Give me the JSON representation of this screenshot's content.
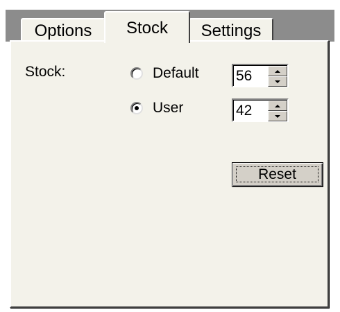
{
  "tabs": {
    "options": "Options",
    "stock": "Stock",
    "settings": "Settings"
  },
  "stock_panel": {
    "label": "Stock:",
    "default_label": "Default",
    "default_value": "56",
    "user_label": "User",
    "user_value": "42",
    "selected": "user",
    "reset_label": "Reset"
  },
  "icons": {
    "spin_up": "up-arrow-icon",
    "spin_down": "down-arrow-icon",
    "radio": "radio-icon"
  },
  "colors": {
    "panel_bg": "#f3f2ea",
    "tabstrip_bg": "#8c8c8c",
    "button_face": "#d4d0c8"
  }
}
